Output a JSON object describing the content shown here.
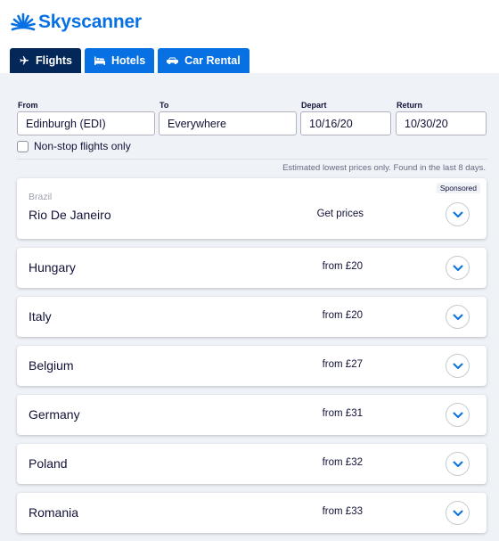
{
  "brand": {
    "name": "Skyscanner",
    "icon": "skyscanner-sunrise-logo",
    "color": "#0770e3"
  },
  "tabs": [
    {
      "label": "Flights",
      "icon": "plane-icon",
      "active": true
    },
    {
      "label": "Hotels",
      "icon": "bed-icon",
      "active": false
    },
    {
      "label": "Car Rental",
      "icon": "car-icon",
      "active": false
    }
  ],
  "search": {
    "from_label": "From",
    "from_value": "Edinburgh (EDI)",
    "to_label": "To",
    "to_value": "Everywhere",
    "depart_label": "Depart",
    "depart_value": "10/16/20",
    "return_label": "Return",
    "return_value": "10/30/20",
    "nonstop_label": "Non-stop flights only",
    "nonstop_checked": false
  },
  "disclaimer": "Estimated lowest prices only. Found in the last 8 days.",
  "results": [
    {
      "category": "Brazil",
      "country": "Rio De Janeiro",
      "price": "Get prices",
      "sponsored": "Sponsored"
    },
    {
      "country": "Hungary",
      "price": "from £20"
    },
    {
      "country": "Italy",
      "price": "from £20"
    },
    {
      "country": "Belgium",
      "price": "from £27"
    },
    {
      "country": "Germany",
      "price": "from £31"
    },
    {
      "country": "Poland",
      "price": "from £32"
    },
    {
      "country": "Romania",
      "price": "from £33"
    }
  ],
  "colors": {
    "accent": "#0770e3",
    "active_tab": "#042759",
    "panel_bg": "#eff3f8"
  }
}
